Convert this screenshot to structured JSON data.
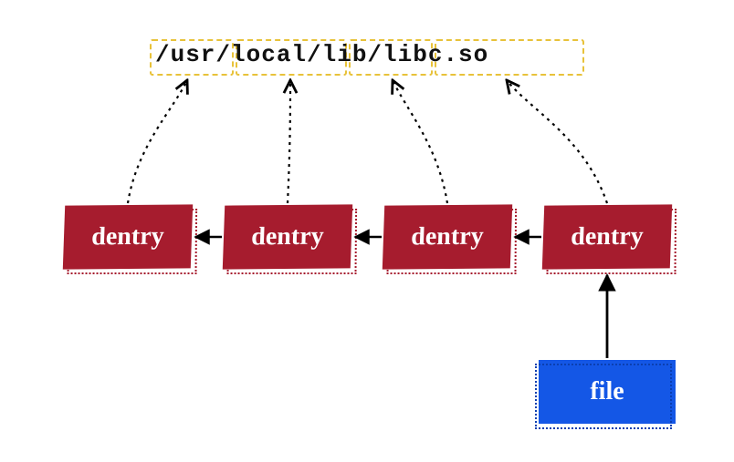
{
  "path": {
    "full": "/usr/local/lib/libc.so",
    "segments": [
      "/usr",
      "/local",
      "/lib",
      "/libc.so"
    ]
  },
  "dentries": [
    {
      "label": "dentry"
    },
    {
      "label": "dentry"
    },
    {
      "label": "dentry"
    },
    {
      "label": "dentry"
    }
  ],
  "file": {
    "label": "file"
  },
  "colors": {
    "dentry_fill": "#a61c2e",
    "file_fill": "#1457e6",
    "segment_border": "#e8c23a",
    "arrow": "#000000"
  },
  "chart_data": {
    "type": "diagram",
    "title": "",
    "nodes": [
      {
        "id": "seg0",
        "kind": "path-segment",
        "label": "/usr"
      },
      {
        "id": "seg1",
        "kind": "path-segment",
        "label": "/local"
      },
      {
        "id": "seg2",
        "kind": "path-segment",
        "label": "/lib"
      },
      {
        "id": "seg3",
        "kind": "path-segment",
        "label": "/libc.so"
      },
      {
        "id": "d0",
        "kind": "dentry",
        "label": "dentry"
      },
      {
        "id": "d1",
        "kind": "dentry",
        "label": "dentry"
      },
      {
        "id": "d2",
        "kind": "dentry",
        "label": "dentry"
      },
      {
        "id": "d3",
        "kind": "dentry",
        "label": "dentry"
      },
      {
        "id": "f0",
        "kind": "file",
        "label": "file"
      }
    ],
    "edges": [
      {
        "from": "d0",
        "to": "seg0",
        "style": "dashed"
      },
      {
        "from": "d1",
        "to": "seg1",
        "style": "dashed"
      },
      {
        "from": "d2",
        "to": "seg2",
        "style": "dashed"
      },
      {
        "from": "d3",
        "to": "seg3",
        "style": "dashed"
      },
      {
        "from": "d1",
        "to": "d0",
        "style": "solid"
      },
      {
        "from": "d2",
        "to": "d1",
        "style": "solid"
      },
      {
        "from": "d3",
        "to": "d2",
        "style": "solid"
      },
      {
        "from": "f0",
        "to": "d3",
        "style": "solid"
      }
    ]
  }
}
